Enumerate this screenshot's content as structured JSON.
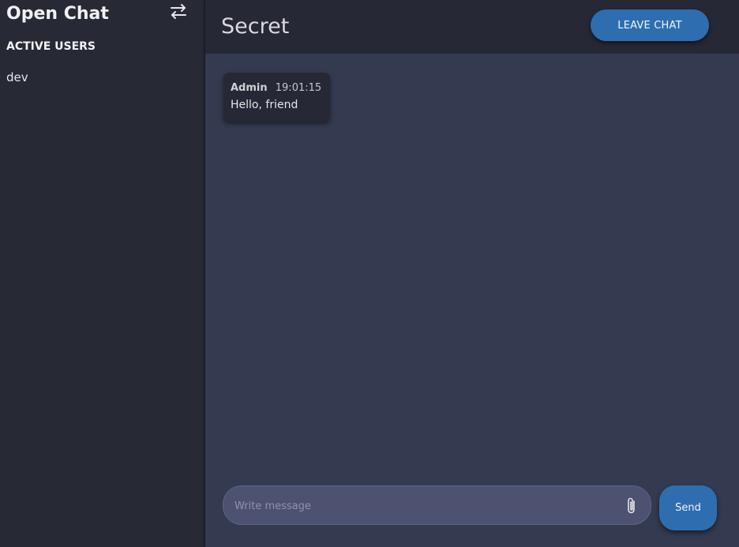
{
  "sidebar": {
    "app_title": "Open Chat",
    "swap_icon": "swap-arrows-icon",
    "active_users_heading": "ACTIVE USERS",
    "users": [
      {
        "name": "dev"
      }
    ]
  },
  "header": {
    "room_title": "Secret",
    "leave_label": "LEAVE CHAT"
  },
  "messages": [
    {
      "author": "Admin",
      "time": "19:01:15",
      "text": "Hello, friend"
    }
  ],
  "composer": {
    "placeholder": "Write message",
    "value": "",
    "attach_icon": "paperclip-icon",
    "send_label": "Send"
  },
  "colors": {
    "sidebar_bg": "#272935",
    "header_bg": "#262835",
    "main_bg": "#343a4f",
    "accent": "#2e6eb0",
    "message_bg": "#262835",
    "input_bg": "#4c5270"
  }
}
